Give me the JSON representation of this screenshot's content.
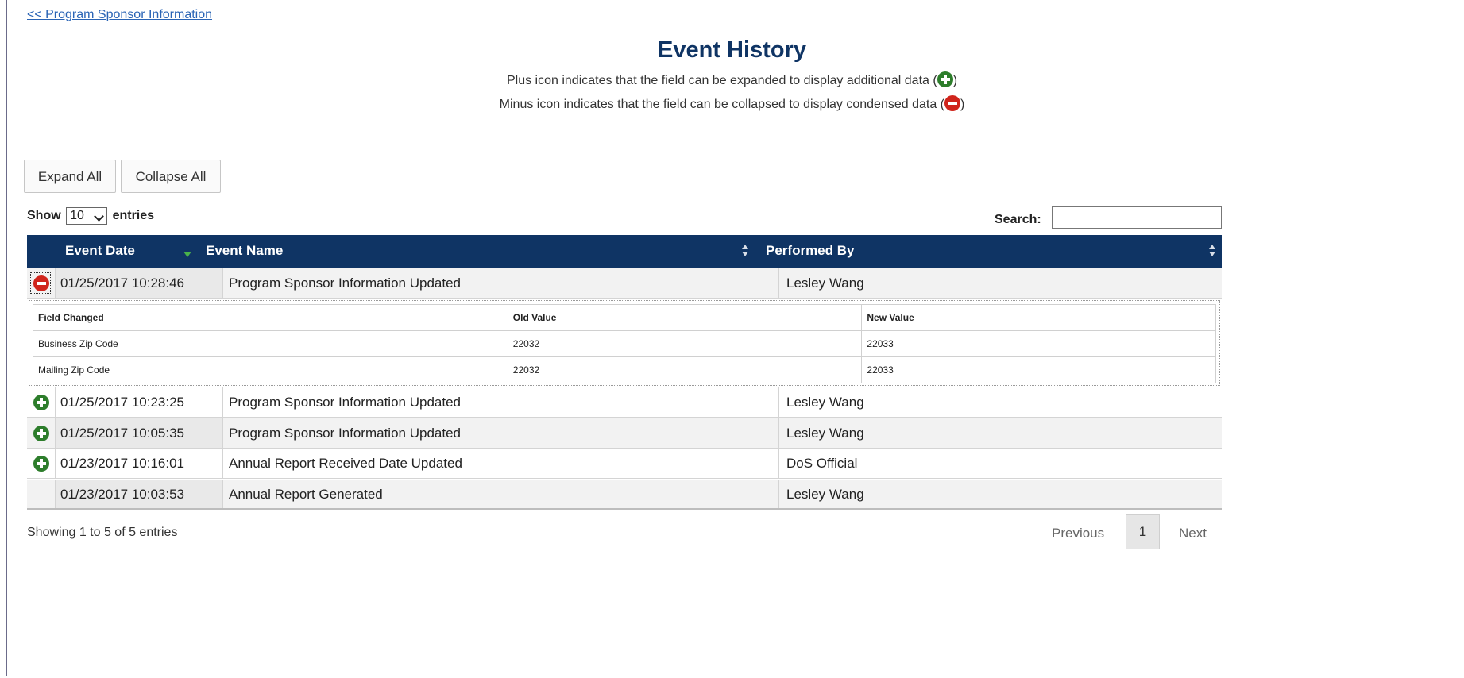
{
  "nav": {
    "back_link": "<<  Program Sponsor Information"
  },
  "page": {
    "title": "Event History",
    "hint_plus": "Plus icon indicates that the field can be expanded to display additional data (",
    "hint_minus": "Minus icon indicates that the field can be collapsed to display condensed data (",
    "hint_close": ")"
  },
  "toolbar": {
    "expand_all": "Expand All",
    "collapse_all": "Collapse All"
  },
  "length": {
    "show": "Show",
    "value": "10",
    "entries": "entries"
  },
  "search": {
    "label": "Search:",
    "value": ""
  },
  "table": {
    "columns": [
      "Event Date",
      "Event Name",
      "Performed By"
    ],
    "rows": [
      {
        "icon": "minus-icon",
        "date": "01/25/2017 10:28:46",
        "name": "Program Sponsor Information Updated",
        "by": "Lesley Wang"
      },
      {
        "icon": "plus-icon",
        "date": "01/25/2017 10:23:25",
        "name": "Program Sponsor Information Updated",
        "by": "Lesley Wang"
      },
      {
        "icon": "plus-icon",
        "date": "01/25/2017 10:05:35",
        "name": "Program Sponsor Information Updated",
        "by": "Lesley Wang"
      },
      {
        "icon": "plus-icon",
        "date": "01/23/2017 10:16:01",
        "name": "Annual Report Received Date Updated",
        "by": "DoS Official"
      },
      {
        "icon": "",
        "date": "01/23/2017 10:03:53",
        "name": "Annual Report Generated",
        "by": "Lesley Wang"
      }
    ]
  },
  "detail": {
    "columns": [
      "Field Changed",
      "Old Value",
      "New Value"
    ],
    "rows": [
      {
        "field": "Business Zip Code",
        "old": "22032",
        "new": "22033"
      },
      {
        "field": "Mailing Zip Code",
        "old": "22032",
        "new": "22033"
      }
    ]
  },
  "footer": {
    "info": "Showing 1 to 5 of 5 entries",
    "previous": "Previous",
    "page": "1",
    "next": "Next"
  },
  "colors": {
    "header_bg": "#0f3464",
    "plus": "#2d7d2b",
    "minus": "#d0241b",
    "link": "#2a64b5"
  }
}
